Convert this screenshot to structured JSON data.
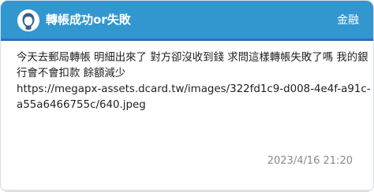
{
  "header": {
    "title": "轉帳成功or失敗",
    "board": "金融",
    "bg_color": "#3397cf",
    "accent_line_color": "#2f6fb4"
  },
  "post": {
    "lines": [
      "今天去郵局轉帳 明細出來了 對方卻沒收到錢 求問這樣轉帳失敗了嗎 我的銀",
      "行會不會扣款 餘額減少",
      "https://megapx-assets.dcard.tw/images/322fd1c9-d008-4e4f-a91c-",
      "a55a6466755c/640.jpeg"
    ],
    "date": "2023/4/16 21:20"
  },
  "icons": {
    "avatar": "anonymous-avatar-icon"
  }
}
